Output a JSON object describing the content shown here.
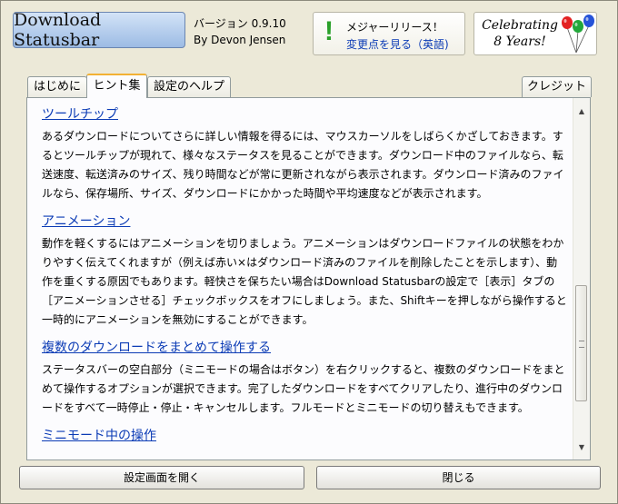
{
  "header": {
    "logo_text": "Download Statusbar",
    "version": "バージョン 0.9.10",
    "author": "By Devon Jensen",
    "release": {
      "title": "メジャーリリース！",
      "link": "変更点を見る（英語)"
    },
    "celebrate": {
      "line1": "Celebrating",
      "line2": "8 Years!"
    }
  },
  "tabs": [
    {
      "label": "はじめに"
    },
    {
      "label": "ヒント集",
      "active": true
    },
    {
      "label": "設定のヘルプ"
    },
    {
      "label": "クレジット"
    }
  ],
  "sections": [
    {
      "title": "ツールチップ",
      "body": "あるダウンロードについてさらに詳しい情報を得るには、マウスカーソルをしばらくかざしておきます。するとツールチップが現れて、様々なステータスを見ることができます。ダウンロード中のファイルなら、転送速度、転送済みのサイズ、残り時間などが常に更新されながら表示されます。ダウンロード済みのファイルなら、保存場所、サイズ、ダウンロードにかかった時間や平均速度などが表示されます。"
    },
    {
      "title": "アニメーション",
      "body": "動作を軽くするにはアニメーションを切りましょう。アニメーションはダウンロードファイルの状態をわかりやすく伝えてくれますが（例えば赤い×はダウンロード済みのファイルを削除したことを示します）、動作を重くする原因でもあります。軽快さを保ちたい場合はDownload Statusbarの設定で［表示］タブの［アニメーションさせる］チェックボックスをオフにしましょう。また、Shiftキーを押しながら操作すると一時的にアニメーションを無効にすることができます。"
    },
    {
      "title": "複数のダウンロードをまとめて操作する",
      "body": "ステータスバーの空白部分（ミニモードの場合はボタン）を右クリックすると、複数のダウンロードをまとめて操作するオプションが選択できます。完了したダウンロードをすべてクリアしたり、進行中のダウンロードをすべて一時停止・停止・キャンセルします。フルモードとミニモードの切り替えもできます。"
    },
    {
      "title": "ミニモード中の操作",
      "body": ""
    }
  ],
  "scrollbar": {
    "up_icon": "▲",
    "down_icon": "▼"
  },
  "buttons": {
    "open_settings": "設定画面を開く",
    "close": "閉じる"
  },
  "colors": {
    "link": "#0b3bb5",
    "active_tab_accent": "#f2b134",
    "bang": "#2aa02a"
  }
}
